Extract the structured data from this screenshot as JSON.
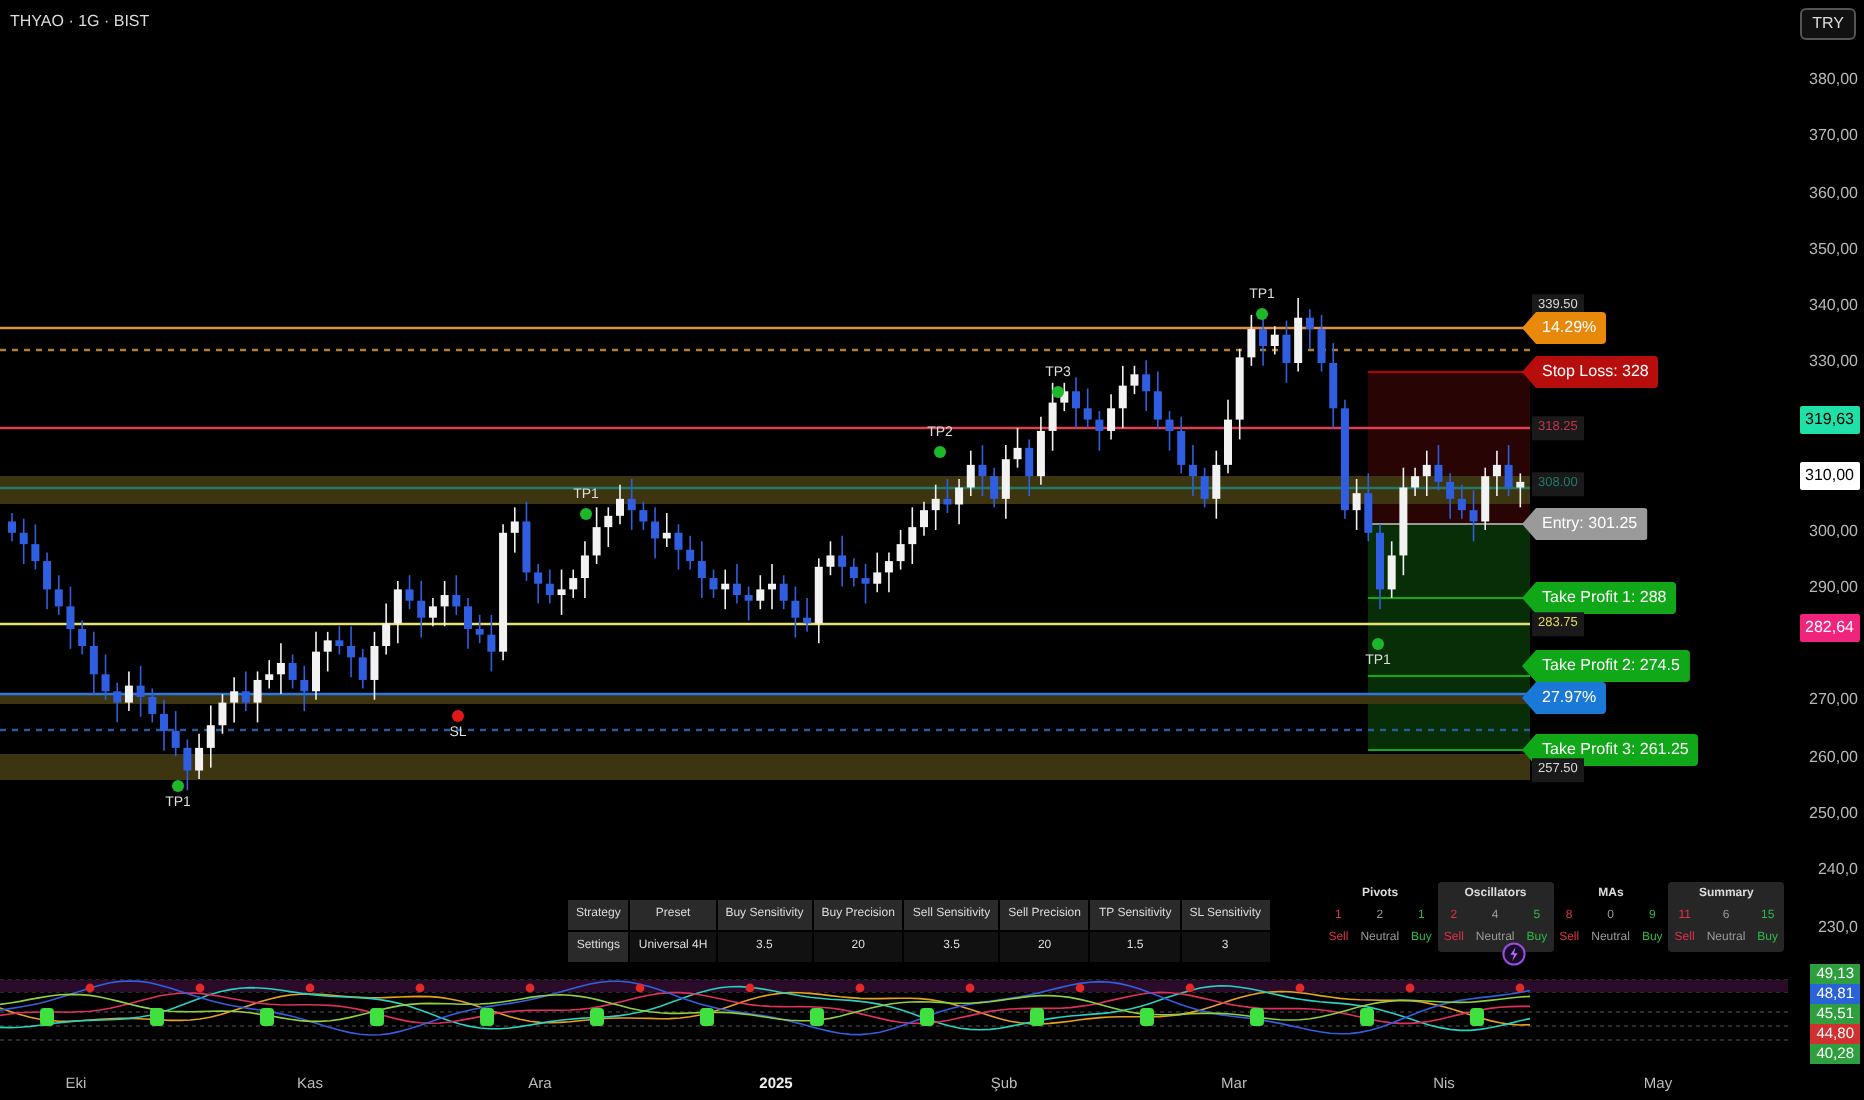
{
  "header": {
    "title": "THYAO · 1G · BIST",
    "currency": "TRY"
  },
  "price_axis": {
    "ticks": [
      "380,00",
      "370,00",
      "360,00",
      "350,00",
      "340,00",
      "330,00",
      "300,00",
      "290,00",
      "270,00",
      "260,00",
      "250,00",
      "240,0",
      "230,0"
    ],
    "badges": [
      {
        "text": "319,63",
        "color": "#1fe0a6"
      },
      {
        "text": "310,00",
        "color": "#ffffff"
      },
      {
        "text": "282,64",
        "color": "#f0247c"
      }
    ]
  },
  "levels": [
    {
      "kind": "value",
      "text": "339.50",
      "color": "#d8d8d8"
    },
    {
      "kind": "callout",
      "text": "14.29%",
      "color": "#e8890c"
    },
    {
      "kind": "callout",
      "text": "Stop Loss: 328",
      "color": "#b80d0d"
    },
    {
      "kind": "value",
      "text": "318.25",
      "color": "#c2334a"
    },
    {
      "kind": "value",
      "text": "308.00",
      "color": "#1f7a66"
    },
    {
      "kind": "callout",
      "text": "Entry: 301.25",
      "color": "#9a9a9a"
    },
    {
      "kind": "callout",
      "text": "Take Profit 1: 288",
      "color": "#10a818"
    },
    {
      "kind": "value",
      "text": "283.75",
      "color": "#e6d95a"
    },
    {
      "kind": "callout",
      "text": "Take Profit 2: 274.5",
      "color": "#10a818"
    },
    {
      "kind": "callout",
      "text": "27.97%",
      "color": "#1a78d6"
    },
    {
      "kind": "callout",
      "text": "Take Profit 3: 261.25",
      "color": "#10a818"
    },
    {
      "kind": "value",
      "text": "257.50",
      "color": "#d8d8d8"
    }
  ],
  "signals": [
    {
      "label": "TP1",
      "kind": "take-profit"
    },
    {
      "label": "SL",
      "kind": "stop-loss"
    },
    {
      "label": "TP1",
      "kind": "take-profit"
    },
    {
      "label": "TP2",
      "kind": "take-profit"
    },
    {
      "label": "TP3",
      "kind": "take-profit"
    },
    {
      "label": "TP1",
      "kind": "take-profit"
    },
    {
      "label": "TP1",
      "kind": "take-profit"
    }
  ],
  "strategy_table": {
    "columns": [
      "Strategy",
      "Preset",
      "Buy Sensitivity",
      "Buy Precision",
      "Sell Sensitivity",
      "Sell Precision",
      "TP Sensitivity",
      "SL Sensitivity"
    ],
    "rows": [
      [
        "Settings",
        "Universal 4H",
        "3.5",
        "20",
        "3.5",
        "20",
        "1.5",
        "3"
      ]
    ]
  },
  "ratings": [
    {
      "title": "Pivots",
      "shaded": false,
      "counts": [
        {
          "kind": "sell",
          "value": "1",
          "label": "Sell"
        },
        {
          "kind": "neutral",
          "value": "2",
          "label": "Neutral"
        },
        {
          "kind": "buy",
          "value": "1",
          "label": "Buy"
        }
      ]
    },
    {
      "title": "Oscillators",
      "shaded": true,
      "counts": [
        {
          "kind": "sell",
          "value": "2",
          "label": "Sell"
        },
        {
          "kind": "neutral",
          "value": "4",
          "label": "Neutral"
        },
        {
          "kind": "buy",
          "value": "5",
          "label": "Buy"
        }
      ]
    },
    {
      "title": "MAs",
      "shaded": false,
      "counts": [
        {
          "kind": "sell",
          "value": "8",
          "label": "Sell"
        },
        {
          "kind": "neutral",
          "value": "0",
          "label": "Neutral"
        },
        {
          "kind": "buy",
          "value": "9",
          "label": "Buy"
        }
      ]
    },
    {
      "title": "Summary",
      "shaded": true,
      "counts": [
        {
          "kind": "sell",
          "value": "11",
          "label": "Sell"
        },
        {
          "kind": "neutral",
          "value": "6",
          "label": "Neutral"
        },
        {
          "kind": "buy",
          "value": "15",
          "label": "Buy"
        }
      ]
    }
  ],
  "oscillator": {
    "badges": [
      {
        "text": "49,13",
        "color": "#2e9e3e"
      },
      {
        "text": "48,81",
        "color": "#2a62d8"
      },
      {
        "text": "45,51",
        "color": "#2e9e3e"
      },
      {
        "text": "44,80",
        "color": "#d03030"
      },
      {
        "text": "40,28",
        "color": "#2e9e3e"
      }
    ]
  },
  "time_axis": [
    {
      "text": "Eki",
      "emphasis": false
    },
    {
      "text": "Kas",
      "emphasis": false
    },
    {
      "text": "Ara",
      "emphasis": false
    },
    {
      "text": "2025",
      "emphasis": true
    },
    {
      "text": "Şub",
      "emphasis": false
    },
    {
      "text": "Mar",
      "emphasis": false
    },
    {
      "text": "Nis",
      "emphasis": false
    },
    {
      "text": "May",
      "emphasis": false
    }
  ]
}
